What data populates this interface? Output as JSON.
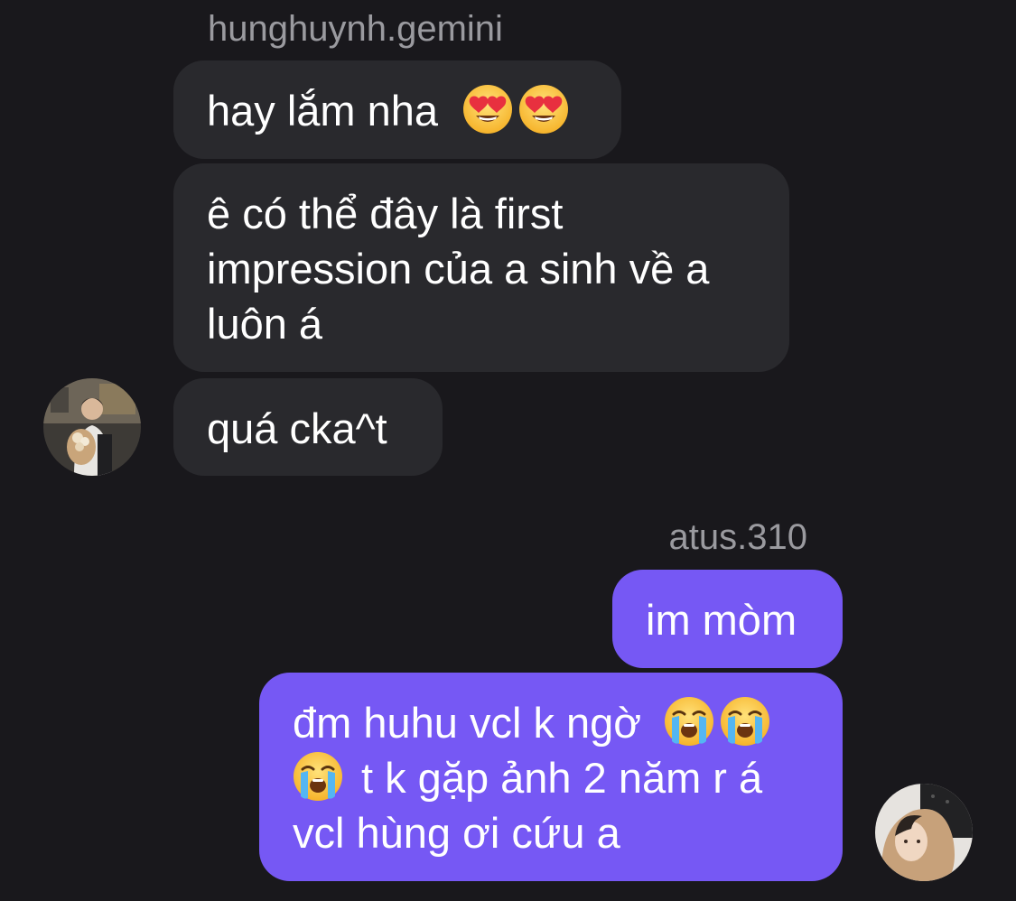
{
  "thread": {
    "incoming": {
      "sender_name": "hunghuynh.gemini",
      "avatar_icon": "profile-photo-man-with-flowers",
      "messages": [
        {
          "text": "hay lắm nha",
          "emoji": [
            "smiling-face-with-heart-eyes",
            "smiling-face-with-heart-eyes"
          ]
        },
        {
          "lines": [
            "ê có thể đây là first",
            "impression của a sinh về a",
            "luôn á"
          ]
        },
        {
          "text": "quá cka^t"
        }
      ]
    },
    "outgoing": {
      "sender_name": "atus.310",
      "avatar_icon": "profile-photo-person-in-hood",
      "messages": [
        {
          "text": "im mòm"
        },
        {
          "line1_text": "đm huhu vcl k ngờ",
          "line2_text": "t k gặp ảnh 2 năm r á",
          "line3_text": "vcl hùng ơi cứu a",
          "emoji": [
            "loudly-crying-face",
            "loudly-crying-face",
            "loudly-crying-face"
          ]
        }
      ]
    }
  },
  "colors": {
    "background": "#19181c",
    "incoming_bubble": "#29292d",
    "outgoing_bubble": "#7658f4",
    "sender_name": "#9a9a9f",
    "text": "#ffffff"
  }
}
